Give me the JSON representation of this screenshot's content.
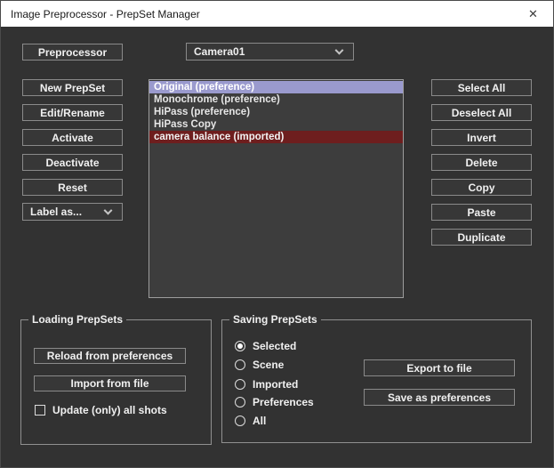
{
  "window": {
    "title": "Image Preprocessor - PrepSet Manager",
    "close_glyph": "✕"
  },
  "colors": {
    "client_bg": "#323232",
    "titlebar_bg": "#ffffff",
    "selection_purple": "#9a9ace",
    "imported_red": "#6e1e1e",
    "button_border": "#8a8a8a"
  },
  "toolbar": {
    "preprocessor_label": "Preprocessor",
    "camera_select": {
      "value": "Camera01",
      "icon": "chevron-down"
    }
  },
  "left_buttons": [
    "New PrepSet",
    "Edit/Rename",
    "Activate",
    "Deactivate",
    "Reset"
  ],
  "label_as_select": {
    "value": "Label as...",
    "icon": "chevron-down"
  },
  "prepset_list": {
    "items": [
      {
        "label": "Original (preference)",
        "state": "selected"
      },
      {
        "label": "Monochrome (preference)",
        "state": "normal"
      },
      {
        "label": "HiPass (preference)",
        "state": "normal"
      },
      {
        "label": "HiPass Copy",
        "state": "normal"
      },
      {
        "label": "camera balance (imported)",
        "state": "imported"
      }
    ]
  },
  "right_buttons": [
    "Select All",
    "Deselect All",
    "Invert",
    "Delete",
    "Copy",
    "Paste",
    "Duplicate"
  ],
  "loading_group": {
    "title": "Loading PrepSets",
    "reload_label": "Reload from preferences",
    "import_label": "Import from file",
    "checkbox": {
      "label": "Update (only) all shots",
      "state": "unchecked"
    }
  },
  "saving_group": {
    "title": "Saving PrepSets",
    "radios": [
      {
        "label": "Selected",
        "state": "checked"
      },
      {
        "label": "Scene",
        "state": "unchecked"
      },
      {
        "label": "Imported",
        "state": "unchecked"
      },
      {
        "label": "Preferences",
        "state": "unchecked"
      },
      {
        "label": "All",
        "state": "unchecked"
      }
    ],
    "export_label": "Export to file",
    "save_label": "Save as preferences"
  }
}
